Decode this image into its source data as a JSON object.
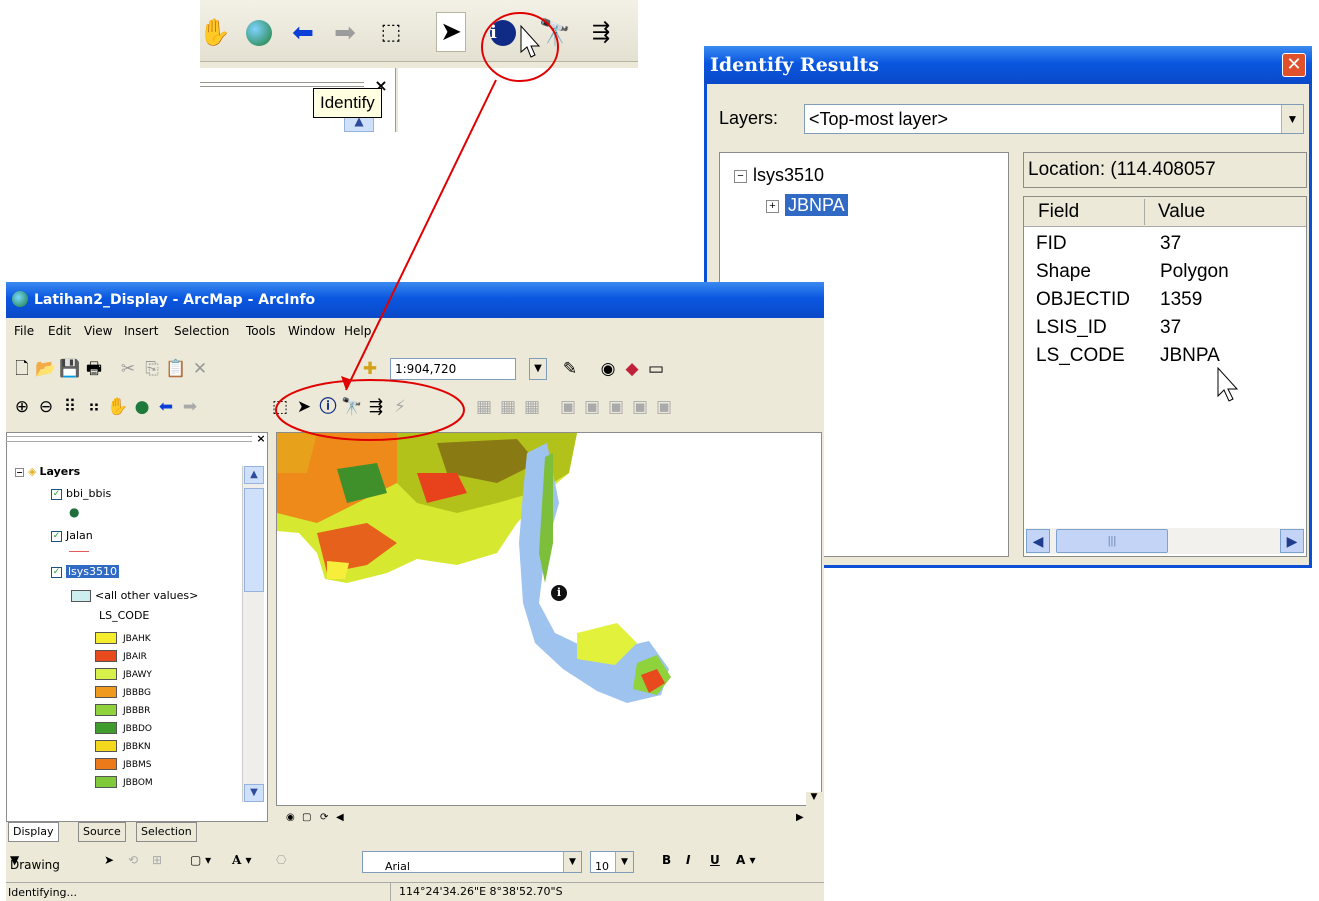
{
  "zoom_toolbar": {
    "tooltip": "Identify",
    "close_glyph": "×",
    "icons": [
      "pan-icon",
      "full-extent-icon",
      "back-arrow-icon",
      "forward-arrow-icon",
      "select-features-icon",
      "select-elements-icon",
      "identify-icon",
      "find-icon",
      "go-to-xy-icon"
    ]
  },
  "identify_window": {
    "title": "Identify Results",
    "close_glyph": "✕",
    "layers_label": "Layers:",
    "layers_value": "<Top-most layer>",
    "tree": {
      "root": "lsys3510",
      "child": "JBNPA"
    },
    "location": "Location: (114.408057",
    "columns": {
      "field": "Field",
      "value": "Value"
    },
    "rows": [
      {
        "field": "FID",
        "value": "37"
      },
      {
        "field": "Shape",
        "value": "Polygon"
      },
      {
        "field": "OBJECTID",
        "value": "1359"
      },
      {
        "field": "LSIS_ID",
        "value": "37"
      },
      {
        "field": "LS_CODE",
        "value": "JBNPA"
      }
    ]
  },
  "arcmap": {
    "title": "Latihan2_Display - ArcMap - ArcInfo",
    "menu": [
      "File",
      "Edit",
      "View",
      "Insert",
      "Selection",
      "Tools",
      "Window",
      "Help"
    ],
    "scale": "1:904,720",
    "toc": {
      "root": "Layers",
      "layers": [
        "bbi_bbis",
        "Jalan",
        "lsys3510"
      ],
      "other_values": "<all other values>",
      "field": "LS_CODE",
      "legend": [
        {
          "code": "JBAHK",
          "color": "#f5ec2e"
        },
        {
          "code": "JBAIR",
          "color": "#e84a1e"
        },
        {
          "code": "JBAWY",
          "color": "#d7f04a"
        },
        {
          "code": "JBBBG",
          "color": "#ef9a1e"
        },
        {
          "code": "JBBBR",
          "color": "#8fd23c"
        },
        {
          "code": "JBBDO",
          "color": "#3f9b2b"
        },
        {
          "code": "JBBKN",
          "color": "#f3d81e"
        },
        {
          "code": "JBBMS",
          "color": "#ec7a1b"
        },
        {
          "code": "JBBOM",
          "color": "#7fc93b"
        }
      ]
    },
    "tabs": [
      "Display",
      "Source",
      "Selection"
    ],
    "drawing_label": "Drawing",
    "font_name": "Arial",
    "font_size": "10",
    "status_left": "Identifying...",
    "status_coords": "114°24'34.26\"E  8°38'52.70\"S"
  },
  "colors": {
    "accent": "#0a57e0",
    "annotation_red": "#e00000",
    "selection": "#316ac5"
  }
}
